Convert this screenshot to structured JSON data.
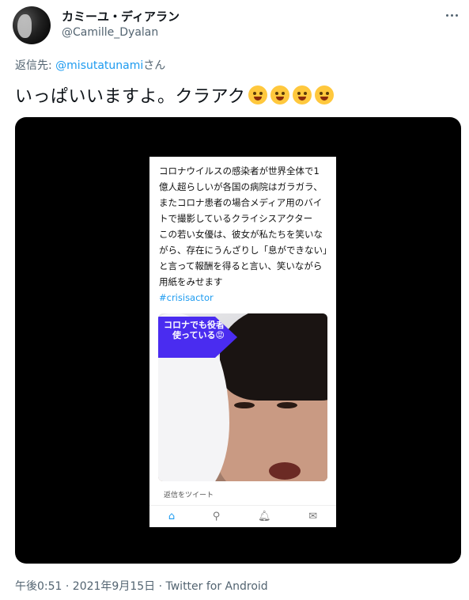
{
  "author": {
    "display_name": "カミーユ・ディアラン",
    "handle": "@Camille_Dyalan"
  },
  "reply": {
    "prefix": "返信先: ",
    "mention": "@misutatunami",
    "suffix": "さん"
  },
  "tweet": {
    "text": "いっぱいいますよ。クラアク",
    "emojis": [
      "zany-face-icon",
      "face-with-hand-over-mouth-icon",
      "rolling-on-floor-laughing-icon",
      "grimacing-face-icon"
    ]
  },
  "media": {
    "embedded_text": "コロナウイルスの感染者が世界全体で1億人超らしいが各国の病院はガラガラ、またコロナ患者の場合メディア用のバイトで撮影しているクライシスアクター\nこの若い女優は、彼女が私たちを笑いながら、存在にうんざりし「息ができない」と言って報酬を得ると言い、笑いながら用紙をみせます",
    "hashtag": "#crisisactor",
    "banner": "コロナでも役者を使っている😡",
    "reply_placeholder": "返信をツイート",
    "nav_icons": [
      "home-icon",
      "search-icon",
      "bell-icon",
      "mail-icon"
    ]
  },
  "footer": {
    "meta": "午後0:51 · 2021年9月15日 · Twitter for Android"
  }
}
